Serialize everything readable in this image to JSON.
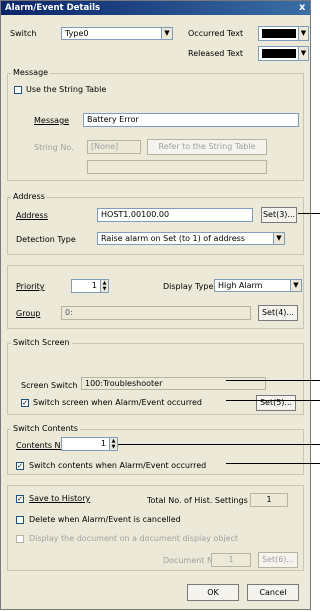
{
  "window": {
    "title": "Alarm/Event Details",
    "close_glyph": "x"
  },
  "switch_row": {
    "label": "Switch",
    "value": "Type0",
    "occurred_label": "Occurred Text",
    "released_label": "Released Text",
    "occurred_color": "#000000",
    "released_color": "#000000"
  },
  "message": {
    "group_title": "Message",
    "use_string_table_label": "Use the String Table",
    "use_string_table_checked": false,
    "message_label": "Message",
    "message_value": "Battery Error",
    "string_no_label": "String No.",
    "string_no_value": "[None]",
    "refer_button": "Refer to the String Table",
    "string_preview": ""
  },
  "address": {
    "group_title": "Address",
    "address_label": "Address",
    "address_value": "HOST1.00100.00",
    "set_button": "Set(3)...",
    "detection_label": "Detection Type",
    "detection_value": "Raise alarm on Set (to 1) of address"
  },
  "priority": {
    "priority_label": "Priority",
    "priority_value": "1",
    "display_type_label": "Display Type",
    "display_type_value": "High Alarm",
    "group_label": "Group",
    "group_value": "0:",
    "set_button": "Set(4)..."
  },
  "switch_screen": {
    "group_title": "Switch Screen",
    "screen_switch_label": "Screen Switch",
    "screen_switch_value": "100:Troubleshooter",
    "check_label": "Switch screen when Alarm/Event occurred",
    "checked": true,
    "set_button": "Set(5)..."
  },
  "switch_contents": {
    "group_title": "Switch Contents",
    "contents_no_label": "Contents No.",
    "contents_no_value": "1",
    "check_label": "Switch contents when Alarm/Event occurred",
    "checked": true
  },
  "history": {
    "save_label": "Save to History",
    "save_checked": true,
    "total_label": "Total No. of Hist. Settings",
    "total_value": "1",
    "delete_label": "Delete when Alarm/Event is cancelled",
    "delete_checked": false,
    "display_doc_label": "Display the document on a document display object",
    "display_doc_checked": false,
    "document_no_label": "Document No.",
    "document_no_value": "1",
    "set_button": "Set(6)..."
  },
  "footer": {
    "ok": "OK",
    "cancel": "Cancel"
  }
}
